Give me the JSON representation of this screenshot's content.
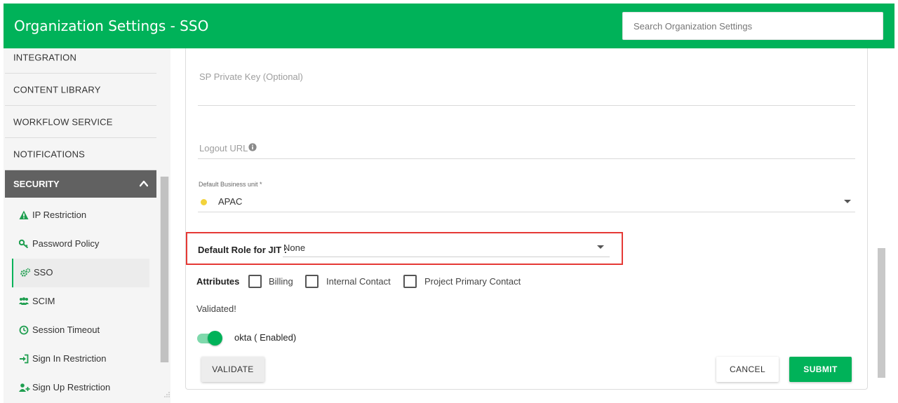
{
  "header": {
    "title": "Organization Settings - SSO",
    "search_placeholder": "Search Organization Settings"
  },
  "sidebar": {
    "items": [
      {
        "label": "INTEGRATION"
      },
      {
        "label": "CONTENT LIBRARY"
      },
      {
        "label": "WORKFLOW SERVICE"
      },
      {
        "label": "NOTIFICATIONS"
      }
    ],
    "section": {
      "label": "SECURITY",
      "expanded": true
    },
    "sub_items": [
      {
        "label": "IP Restriction",
        "icon": "warning-icon"
      },
      {
        "label": "Password Policy",
        "icon": "key-icon"
      },
      {
        "label": "SSO",
        "icon": "gears-icon",
        "active": true
      },
      {
        "label": "SCIM",
        "icon": "users-icon"
      },
      {
        "label": "Session Timeout",
        "icon": "clock-icon"
      },
      {
        "label": "Sign In Restriction",
        "icon": "sign-in-icon"
      },
      {
        "label": "Sign Up Restriction",
        "icon": "user-plus-icon"
      }
    ]
  },
  "form": {
    "sp_private_key_placeholder": "SP Private Key (Optional)",
    "logout_url_placeholder": "Logout URL",
    "default_business_unit_label": "Default Business unit *",
    "default_business_unit_value": "APAC",
    "default_business_unit_dot_color": "#f2d33c",
    "default_role_label": "Default Role for JIT :",
    "default_role_value": "None",
    "attributes_label": "Attributes",
    "attributes": [
      {
        "label": "Billing",
        "checked": false
      },
      {
        "label": "Internal Contact",
        "checked": false
      },
      {
        "label": "Project Primary Contact",
        "checked": false
      }
    ],
    "status_text": "Validated!",
    "toggle_label": "okta ( Enabled)",
    "toggle_on": true
  },
  "buttons": {
    "validate": "VALIDATE",
    "cancel": "CANCEL",
    "submit": "SUBMIT"
  },
  "colors": {
    "brand": "#00b259",
    "highlight_border": "#e53935",
    "sidebar_section_bg": "#616161"
  }
}
